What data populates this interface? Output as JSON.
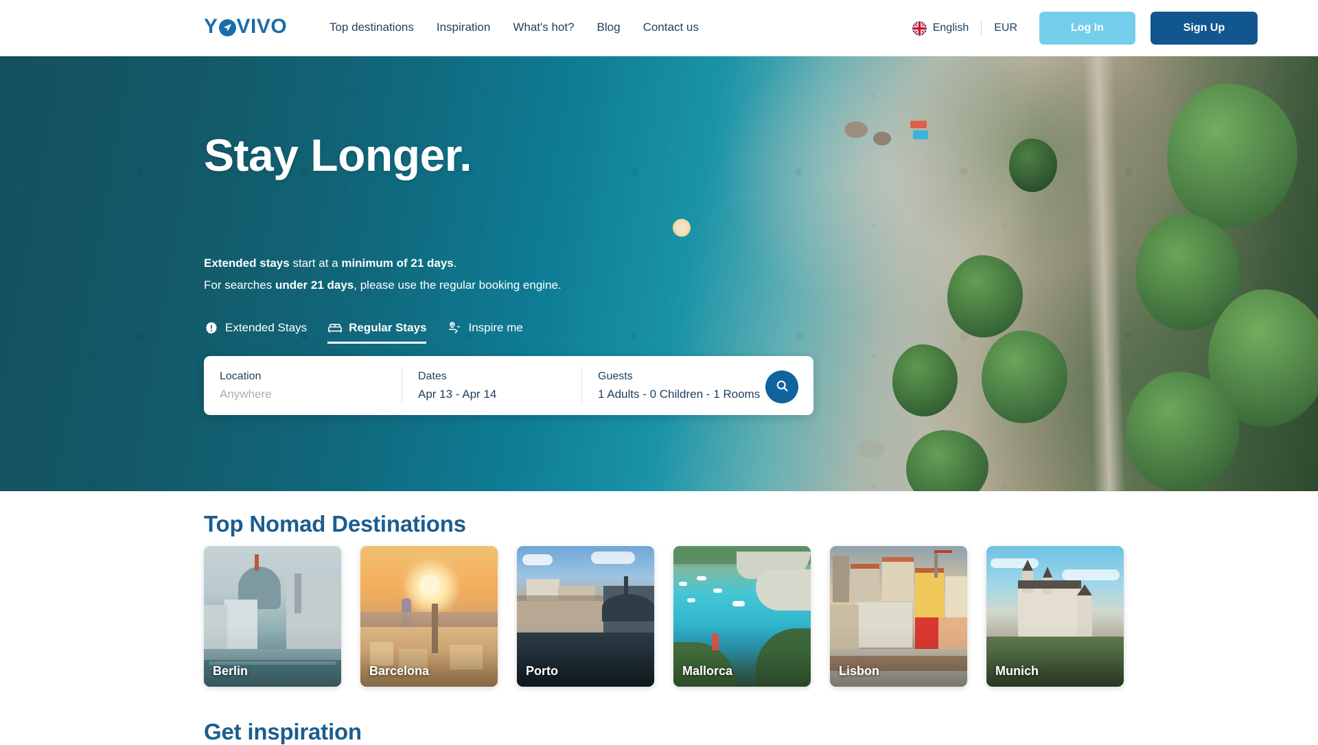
{
  "header": {
    "logo": {
      "text_before": "Y",
      "icon": "paper-plane-icon",
      "text_after": "VIVO",
      "full": "YOVIVO"
    },
    "nav": [
      {
        "label": "Top destinations"
      },
      {
        "label": "Inspiration"
      },
      {
        "label": "What's hot?"
      },
      {
        "label": "Blog"
      },
      {
        "label": "Contact us"
      }
    ],
    "language": {
      "icon": "uk-flag-icon",
      "label": "English"
    },
    "currency": "EUR",
    "login_label": "Log In",
    "signup_label": "Sign Up",
    "colors": {
      "login_bg": "#74cdeb",
      "signup_bg": "#11568f",
      "nav_text": "#1c3f5e",
      "logo": "#1b6ca8"
    }
  },
  "hero": {
    "title": "Stay Longer.",
    "subtitle_line1": {
      "bold1": "Extended stays",
      "mid": " start at a ",
      "bold2": "minimum of 21 days",
      "end": "."
    },
    "subtitle_line2": {
      "start": "For searches ",
      "bold1": "under 21 days",
      "end": ", please use the regular booking engine."
    },
    "tabs": [
      {
        "label": "Extended Stays",
        "icon": "alert-badge-icon",
        "active": false
      },
      {
        "label": "Regular Stays",
        "icon": "bed-icon",
        "active": true
      },
      {
        "label": "Inspire me",
        "icon": "map-pin-route-icon",
        "active": false
      }
    ],
    "search": {
      "location": {
        "label": "Location",
        "value": "",
        "placeholder": "Anywhere"
      },
      "dates": {
        "label": "Dates",
        "value": "Apr 13 - Apr 14"
      },
      "guests": {
        "label": "Guests",
        "value": "1 Adults - 0 Children - 1 Rooms"
      },
      "search_icon": "search-icon",
      "search_button_color": "#11639e"
    }
  },
  "main": {
    "nomad_section_title": "Top Nomad Destinations",
    "inspiration_section_title": "Get inspiration",
    "destinations": [
      {
        "label": "Berlin",
        "img_class": "img-berlin"
      },
      {
        "label": "Barcelona",
        "img_class": "img-barcelona"
      },
      {
        "label": "Porto",
        "img_class": "img-porto"
      },
      {
        "label": "Mallorca",
        "img_class": "img-mallorca"
      },
      {
        "label": "Lisbon",
        "img_class": "img-lisbon"
      },
      {
        "label": "Munich",
        "img_class": "img-munich"
      }
    ],
    "accent_color": "#1b5d8f"
  }
}
